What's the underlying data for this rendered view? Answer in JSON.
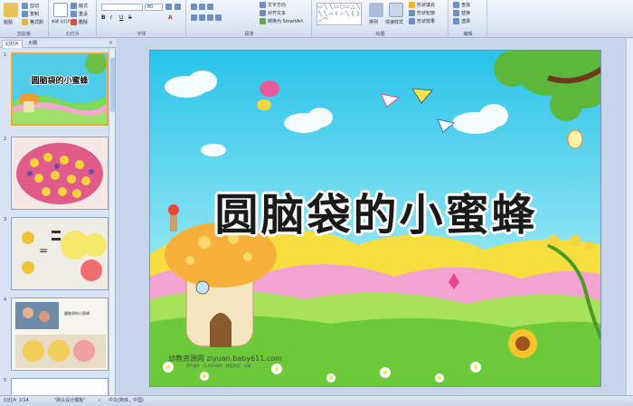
{
  "ribbon": {
    "clipboard": {
      "label": "剪贴板",
      "paste": "粘贴",
      "cut": "剪切",
      "copy": "复制",
      "format_painter": "格式刷"
    },
    "slides": {
      "label": "幻灯片",
      "new_slide": "新建\n幻灯片",
      "layout": "版式",
      "reset": "重设",
      "delete": "删除"
    },
    "font": {
      "label": "字体",
      "font_size": "80",
      "bold": "B",
      "italic": "I",
      "underline": "U",
      "strike": "S",
      "font_color": "A"
    },
    "paragraph": {
      "label": "段落",
      "text_direction": "文字方向",
      "align_text": "对齐文本",
      "smartart": "转换为 SmartArt"
    },
    "drawing": {
      "label": "绘图",
      "arrange": "排列",
      "quick_styles": "快速样式",
      "shape_fill": "形状填充",
      "shape_outline": "形状轮廓",
      "shape_effects": "形状效果"
    },
    "editing": {
      "label": "编辑",
      "find": "查找",
      "replace": "替换",
      "select": "选择"
    },
    "shapes": [
      "▭",
      "╲",
      "╲",
      "▭",
      "○",
      "▭",
      "△",
      "╲",
      "╲",
      "╲",
      "⇨",
      "⇩",
      "☆",
      "╲",
      "{",
      "}",
      "☆",
      "⌒"
    ]
  },
  "tabs": {
    "slides": "幻灯片",
    "outline": "大纲"
  },
  "thumbnails": [
    {
      "num": "1",
      "title": "圆脑袋的小蜜蜂"
    },
    {
      "num": "2"
    },
    {
      "num": "3"
    },
    {
      "num": "4",
      "caption": "圆脑袋的小蜜蜂"
    },
    {
      "num": "5"
    }
  ],
  "slide": {
    "title": "圆脑袋的小蜜蜂",
    "watermark": "幼教资源网 ziyuan.baby611.com",
    "watermark_sub": "PPT课件 · FLASH课件 · 教案教案 · 试卷"
  },
  "status": {
    "slide_counter": "幻灯片 1/14",
    "theme": "\"默认设计模板\"",
    "language": "中文(简体，中国)"
  },
  "colors": {
    "accent": "#f3a63b",
    "ribbon_bg": "#dde8f6",
    "panel_bg": "#d8e3f3"
  }
}
